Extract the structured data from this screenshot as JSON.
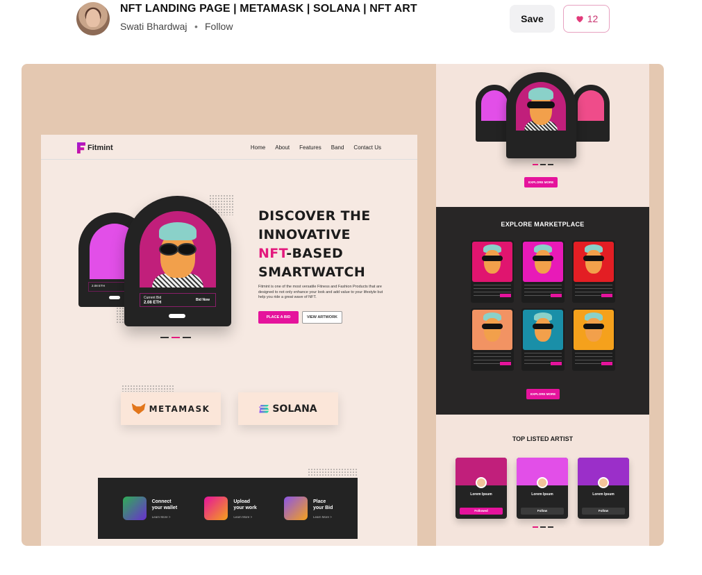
{
  "header": {
    "title": "NFT LANDING PAGE | METAMASK | SOLANA | NFT ART",
    "author": "Swati Bhardwaj",
    "separator": "•",
    "follow_label": "Follow",
    "save_label": "Save",
    "like_count": "12"
  },
  "landing": {
    "logo": "Fitmint",
    "nav": [
      "Home",
      "About",
      "Features",
      "Band",
      "Contact Us"
    ],
    "hero_line1": "DISCOVER THE",
    "hero_line2": "INNOVATIVE",
    "hero_pink": "NFT",
    "hero_line3_rest": "-BASED",
    "hero_line4": "SMARTWATCH",
    "hero_text": "Fitmint is one of the most versatile Fitness and Fashion Products that are designed to not only enhance your look and add value to your lifestyle but help you ride a great wave of NFT.",
    "place_bid": "PLACE A BID",
    "view_artwork": "VIEW ARTWORK",
    "card_price_label": "Current Bid",
    "card_price": "2.08 ETH",
    "back_card_price": "2.08 ETH",
    "card_bid": "Bid Now",
    "brands": [
      "METAMASK",
      "SOLANA"
    ],
    "steps": [
      {
        "line1": "Connect",
        "line2": "your wallet",
        "more": "Learn More >"
      },
      {
        "line1": "Upload",
        "line2": "your work",
        "more": "Learn More >"
      },
      {
        "line1": "Place",
        "line2": "your Bid",
        "more": "Learn More >"
      }
    ]
  },
  "right": {
    "explore_more": "EXPLORE MORE",
    "marketplace_title": "EXPLORE MARKETPLACE",
    "explore_more_2": "EXPLORE MORE",
    "artist_title": "TOP LISTED ARTIST",
    "artists": [
      {
        "name": "Lorem Ipsum",
        "button": "Followed"
      },
      {
        "name": "Lorem Ipsum",
        "button": "Follow"
      },
      {
        "name": "Lorem Ipsum",
        "button": "Follow"
      }
    ],
    "market_colors": [
      "#e0156f",
      "#e81ab8",
      "#e31e24",
      "#f29363",
      "#1a8fa8",
      "#f5a11c"
    ]
  },
  "colors": {
    "accent": "#e5139c",
    "canvas": "#e4c8b1",
    "dark": "#232323"
  }
}
